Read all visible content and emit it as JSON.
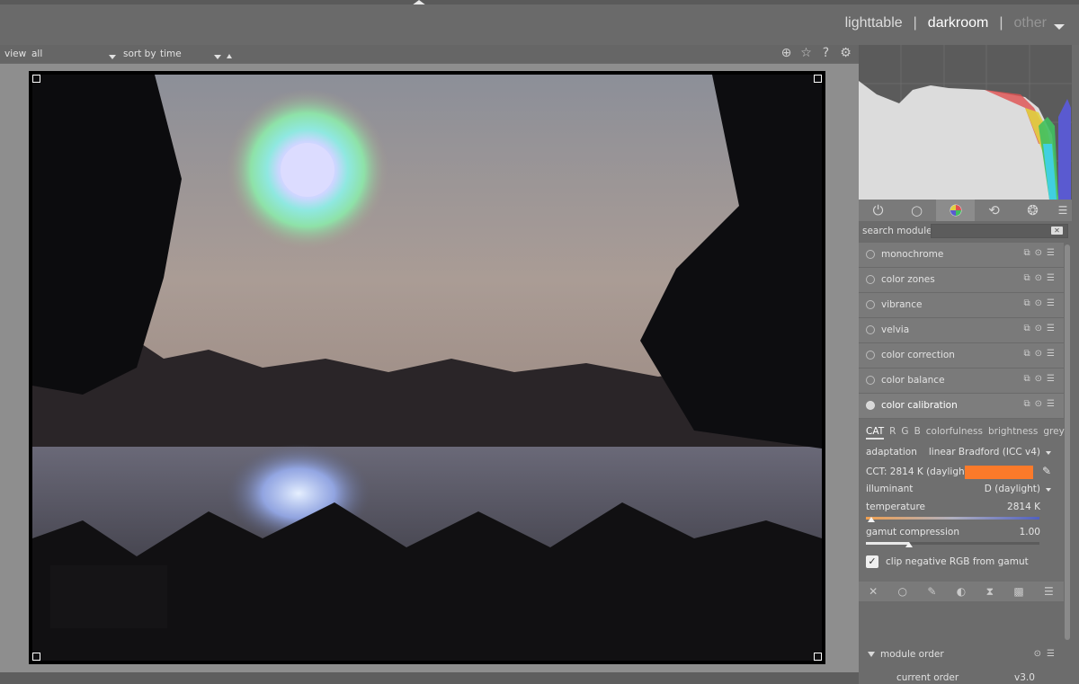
{
  "header": {
    "views": [
      {
        "label": "lighttable",
        "state": "normal"
      },
      {
        "label": "darkroom",
        "state": "active"
      },
      {
        "label": "other",
        "state": "dim"
      }
    ],
    "separator": "|"
  },
  "filterbar": {
    "view_label": "view",
    "view_value": "all",
    "sort_label": "sort by",
    "sort_value": "time"
  },
  "top_icons": [
    "grouping-icon",
    "star-icon",
    "help-icon",
    "gear-icon"
  ],
  "module_tabs": [
    "power-icon",
    "circle-icon",
    "color-icon",
    "correct-icon",
    "effect-icon"
  ],
  "search": {
    "label": "search module",
    "value": ""
  },
  "modules": [
    {
      "name": "monochrome",
      "on": false
    },
    {
      "name": "color zones",
      "on": false
    },
    {
      "name": "vibrance",
      "on": false
    },
    {
      "name": "velvia",
      "on": false
    },
    {
      "name": "color correction",
      "on": false
    },
    {
      "name": "color balance",
      "on": false
    },
    {
      "name": "color calibration",
      "on": true
    }
  ],
  "color_calibration": {
    "tabs": [
      "CAT",
      "R",
      "G",
      "B",
      "colorfulness",
      "brightness",
      "grey"
    ],
    "active_tab": "CAT",
    "adaptation_label": "adaptation",
    "adaptation_value": "linear Bradford (ICC v4)",
    "cct_label": "CCT: 2814 K (daylight)",
    "cct_color": "#fb7a2a",
    "illuminant_label": "illuminant",
    "illuminant_value": "D (daylight)",
    "temperature_label": "temperature",
    "temperature_value": "2814 K",
    "temperature_fraction": 0.03,
    "gamut_label": "gamut compression",
    "gamut_value": "1.00",
    "gamut_fraction": 0.25,
    "clip_label": "clip negative RGB from gamut",
    "clip_checked": true
  },
  "module_order": {
    "title": "module order",
    "current_label": "current order",
    "current_value": "v3.0"
  }
}
